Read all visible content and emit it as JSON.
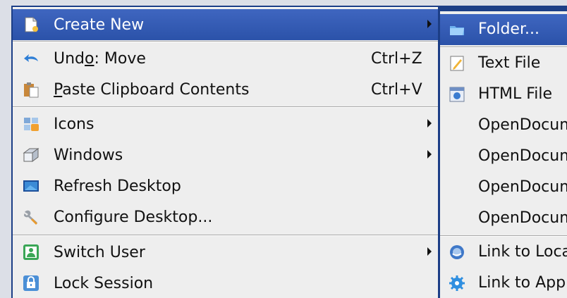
{
  "context_menu": {
    "items": [
      {
        "label": "Create New",
        "icon": "new-document-icon",
        "has_submenu": true,
        "highlighted": true
      },
      {
        "label_pre": "Und",
        "mnemonic": "o",
        "label_post": ": Move",
        "icon": "undo-arrow-icon",
        "shortcut": "Ctrl+Z"
      },
      {
        "mnemonic": "P",
        "label_post": "aste Clipboard Contents",
        "icon": "paste-clipboard-icon",
        "shortcut": "Ctrl+V"
      },
      {
        "label": "Icons",
        "icon": "icons-folder-icon",
        "has_submenu": true
      },
      {
        "label": "Windows",
        "icon": "windows-icon",
        "has_submenu": true
      },
      {
        "label": "Refresh Desktop",
        "icon": "refresh-desktop-icon"
      },
      {
        "label": "Configure Desktop...",
        "icon": "wrench-icon"
      },
      {
        "label": "Switch User",
        "icon": "switch-user-icon",
        "has_submenu": true
      },
      {
        "label": "Lock Session",
        "icon": "lock-icon"
      }
    ]
  },
  "submenu": {
    "items": [
      {
        "label": "Folder...",
        "icon": "folder-icon",
        "highlighted": true
      },
      {
        "label": "Text File",
        "icon": "text-file-icon"
      },
      {
        "label": "HTML File",
        "icon": "html-file-icon"
      },
      {
        "label": "OpenDocument",
        "icon": ""
      },
      {
        "label": "OpenDocument",
        "icon": ""
      },
      {
        "label": "OpenDocument",
        "icon": ""
      },
      {
        "label": "OpenDocument",
        "icon": ""
      },
      {
        "label": "Link to Location",
        "icon": "link-location-icon"
      },
      {
        "label": "Link to Application",
        "icon": "link-application-icon"
      }
    ]
  },
  "colors": {
    "highlight": "#2f57ae",
    "menu_background": "#eeeeee",
    "frame": "#1c3e86"
  }
}
